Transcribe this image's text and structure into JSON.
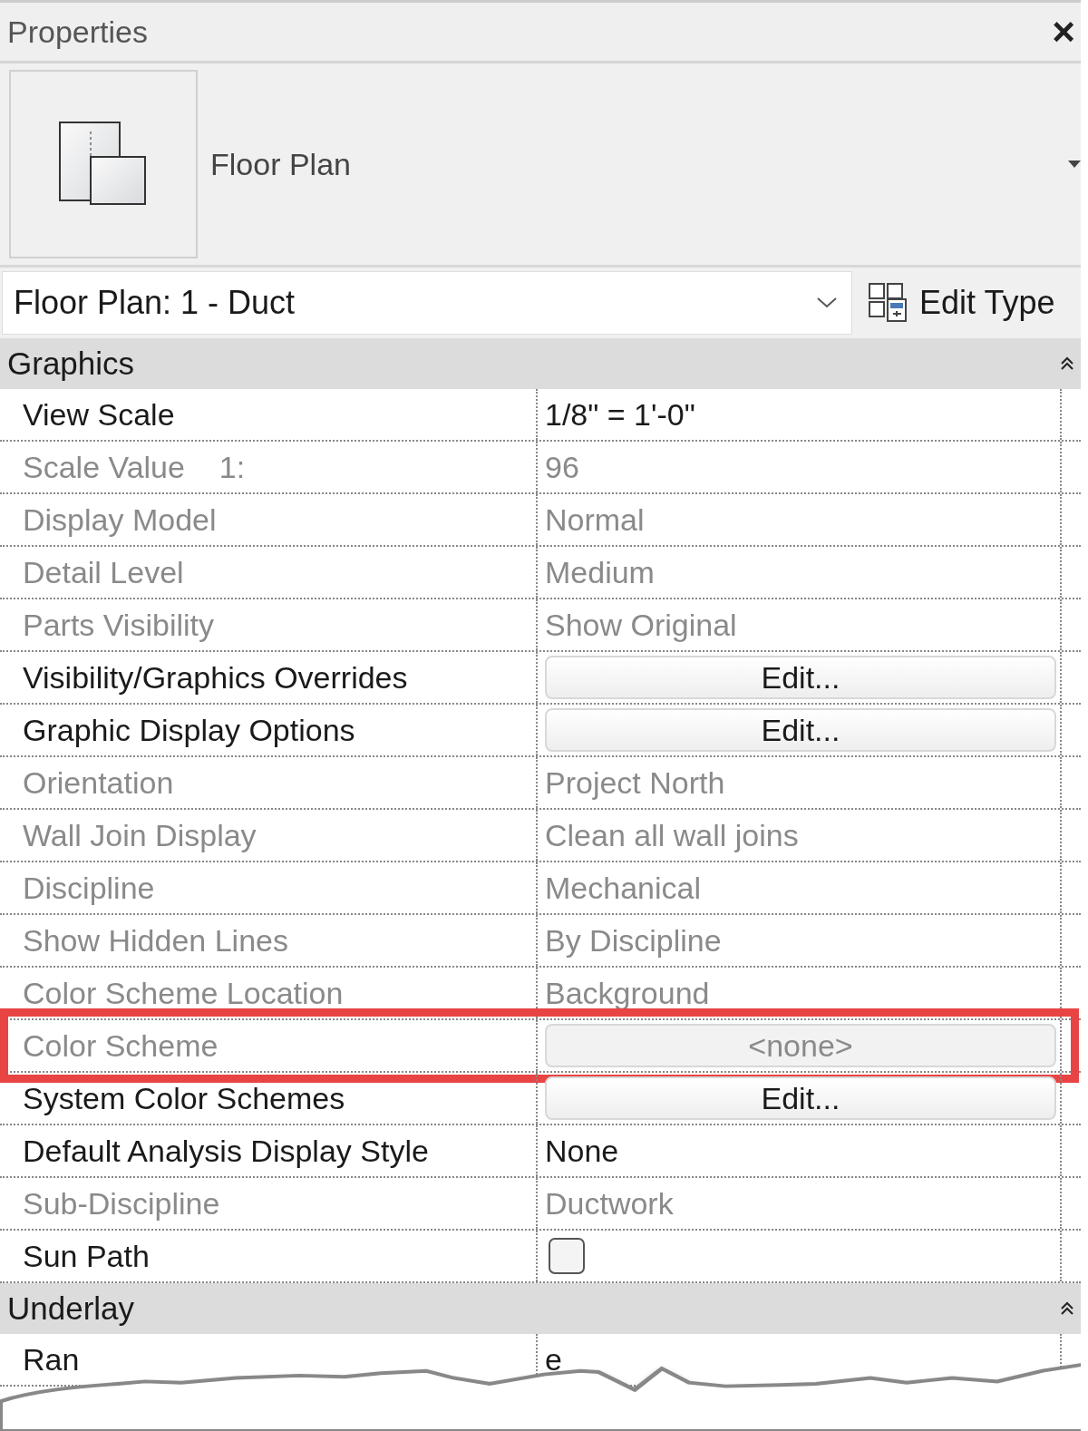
{
  "window": {
    "title": "Properties",
    "close": "×"
  },
  "type": {
    "name": "Floor Plan"
  },
  "selector": {
    "value": "Floor Plan: 1 - Duct",
    "edit_type": "Edit Type"
  },
  "groups": [
    {
      "title": "Graphics",
      "expanded": true,
      "rows": [
        {
          "label": "View Scale",
          "value": "1/8\" = 1'-0\"",
          "kind": "text",
          "editable": true,
          "highlighted": false
        },
        {
          "label": "Scale Value    1:",
          "value": "96",
          "kind": "text",
          "editable": false,
          "highlighted": false
        },
        {
          "label": "Display Model",
          "value": "Normal",
          "kind": "text",
          "editable": false,
          "highlighted": false
        },
        {
          "label": "Detail Level",
          "value": "Medium",
          "kind": "text",
          "editable": false,
          "highlighted": false
        },
        {
          "label": "Parts Visibility",
          "value": "Show Original",
          "kind": "text",
          "editable": false,
          "highlighted": false
        },
        {
          "label": "Visibility/Graphics Overrides",
          "value": "Edit...",
          "kind": "button",
          "editable": true,
          "highlighted": false
        },
        {
          "label": "Graphic Display Options",
          "value": "Edit...",
          "kind": "button",
          "editable": true,
          "highlighted": false
        },
        {
          "label": "Orientation",
          "value": "Project North",
          "kind": "text",
          "editable": false,
          "highlighted": false
        },
        {
          "label": "Wall Join Display",
          "value": "Clean all wall joins",
          "kind": "text",
          "editable": false,
          "highlighted": false
        },
        {
          "label": "Discipline",
          "value": "Mechanical",
          "kind": "text",
          "editable": false,
          "highlighted": false
        },
        {
          "label": "Show Hidden Lines",
          "value": "By Discipline",
          "kind": "text",
          "editable": false,
          "highlighted": false
        },
        {
          "label": "Color Scheme Location",
          "value": "Background",
          "kind": "text",
          "editable": false,
          "highlighted": false
        },
        {
          "label": "Color Scheme",
          "value": "<none>",
          "kind": "button",
          "editable": false,
          "highlighted": true
        },
        {
          "label": "System Color Schemes",
          "value": "Edit...",
          "kind": "button",
          "editable": true,
          "highlighted": false
        },
        {
          "label": "Default Analysis Display Style",
          "value": "None",
          "kind": "text",
          "editable": true,
          "highlighted": false
        },
        {
          "label": "Sub-Discipline",
          "value": "Ductwork",
          "kind": "text",
          "editable": false,
          "highlighted": false
        },
        {
          "label": "Sun Path",
          "kind": "checkbox",
          "checked": false,
          "editable": true,
          "highlighted": false
        }
      ]
    },
    {
      "title": "Underlay",
      "expanded": true,
      "rows": [
        {
          "label": "Ran",
          "value": "e",
          "kind": "text",
          "editable": true,
          "highlighted": false
        }
      ]
    }
  ]
}
